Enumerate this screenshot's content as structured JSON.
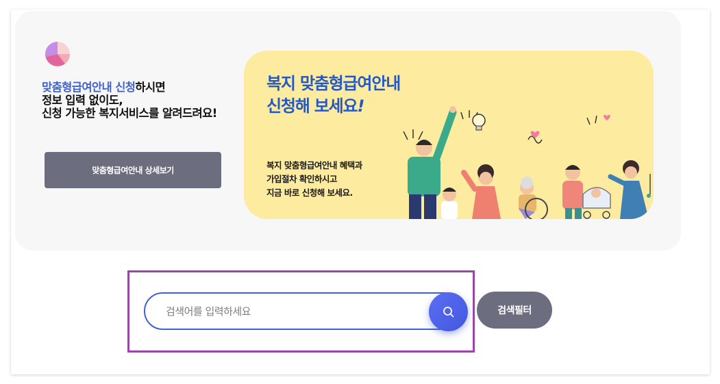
{
  "intro": {
    "highlight": "맞춤형급여안내 신청",
    "line1_rest": "하시면",
    "line2": "정보 입력 없이도,",
    "line3": "신청 가능한 복지서비스를 알려드려요!"
  },
  "detail_button_label": "맞춤형급여안내 상세보기",
  "banner": {
    "title_line1": "복지 맞춤형급여안내",
    "title_line2": "신청해 보세요",
    "title_exclaim": "!",
    "desc_line1": "복지 맞춤형급여안내 혜택과",
    "desc_line2": "가입절차 확인하시고",
    "desc_line3": "지금 바로 신청해 보세요."
  },
  "search": {
    "placeholder": "검색어를 입력하세요",
    "value": "",
    "icon": "search-icon"
  },
  "filter_button_label": "검색필터",
  "colors": {
    "accent_blue": "#3f63d0",
    "banner_bg": "#fdeca0",
    "button_gray": "#6c6e7f",
    "search_border": "#3f5fd4",
    "highlight_outline": "#9b45a8"
  }
}
